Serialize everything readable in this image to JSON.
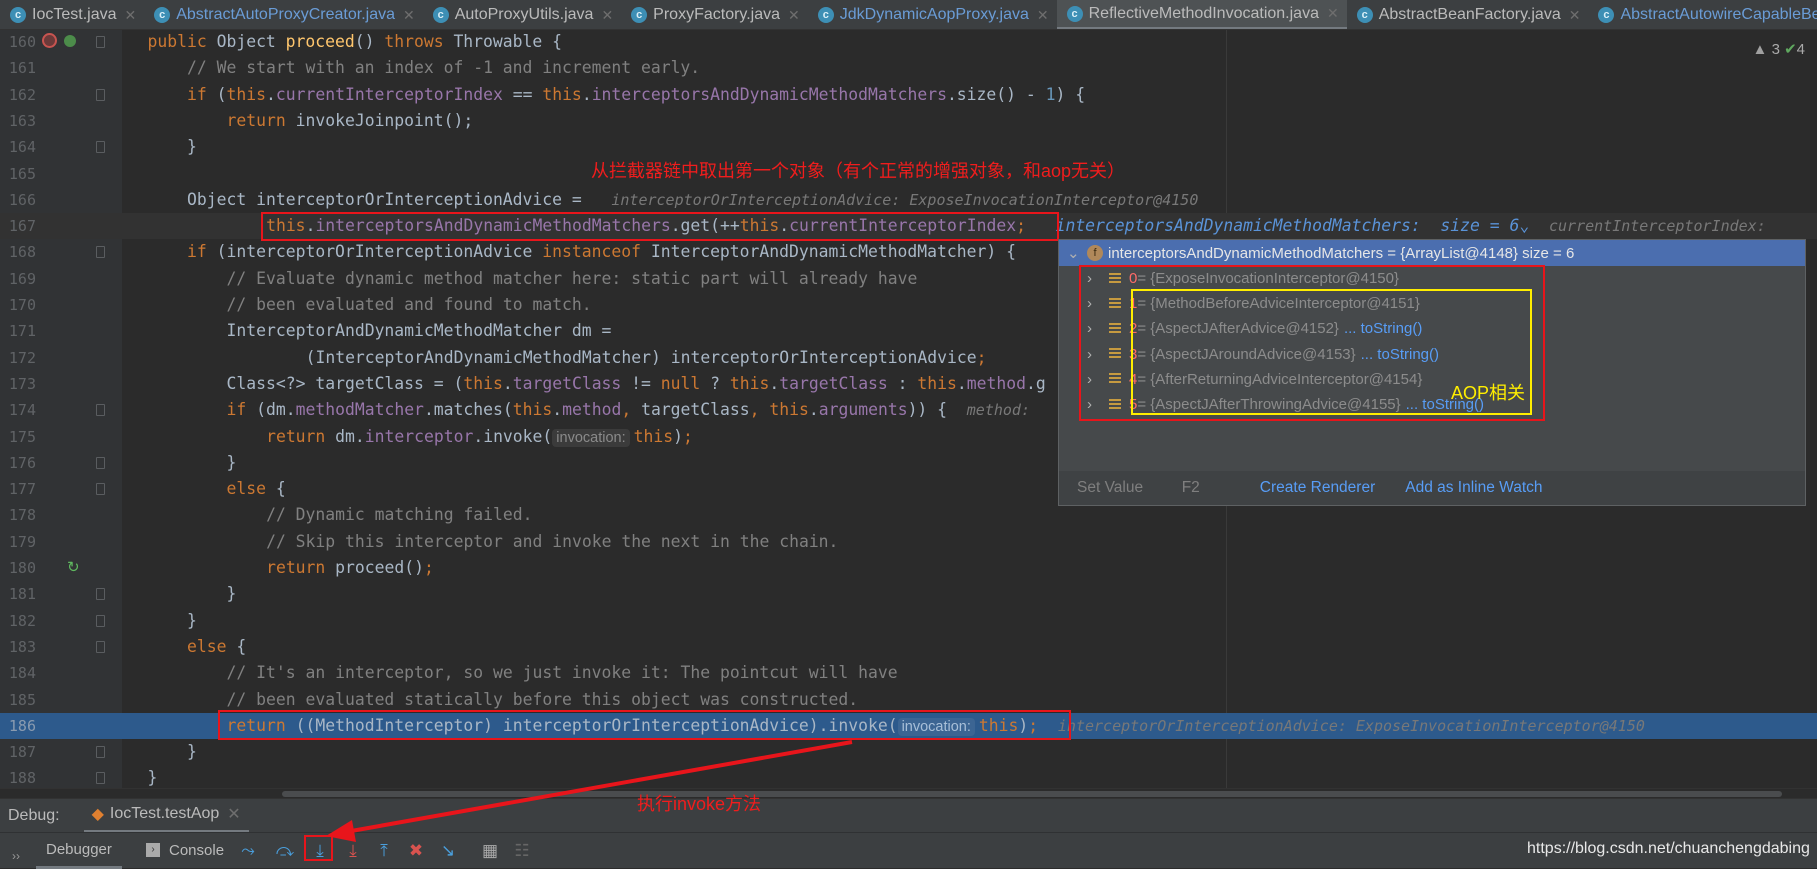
{
  "tabs": [
    {
      "label": "IocTest.java",
      "style": "normal"
    },
    {
      "label": "AbstractAutoProxyCreator.java",
      "style": "blue"
    },
    {
      "label": "AutoProxyUtils.java",
      "style": "normal"
    },
    {
      "label": "ProxyFactory.java",
      "style": "normal"
    },
    {
      "label": "JdkDynamicAopProxy.java",
      "style": "blue"
    },
    {
      "label": "ReflectiveMethodInvocation.java",
      "style": "active"
    },
    {
      "label": "AbstractBeanFactory.java",
      "style": "normal"
    },
    {
      "label": "AbstractAutowireCapableBeanFactory.java",
      "style": "blue"
    }
  ],
  "inspections": {
    "warnings": "3",
    "ok": "4"
  },
  "current_line": 167,
  "execution_line": 186,
  "code": [
    {
      "n": "160",
      "i": 1,
      "t": [
        [
          "kw",
          "public "
        ],
        [
          "",
          "Object "
        ],
        [
          "fn",
          "proceed"
        ],
        [
          "",
          "() "
        ],
        [
          "kw",
          "throws "
        ],
        [
          "",
          "Throwable {"
        ]
      ]
    },
    {
      "n": "161",
      "i": 2,
      "t": [
        [
          "cm",
          "// We start with an index of -1 and increment early."
        ]
      ]
    },
    {
      "n": "162",
      "i": 2,
      "t": [
        [
          "kw",
          "if "
        ],
        [
          "",
          "("
        ],
        [
          "kw",
          "this"
        ],
        [
          "",
          "."
        ],
        [
          "fld",
          "currentInterceptorIndex"
        ],
        [
          "",
          " == "
        ],
        [
          "kw",
          "this"
        ],
        [
          "",
          "."
        ],
        [
          "fld",
          "interceptorsAndDynamicMethodMatchers"
        ],
        [
          "",
          ".size() - "
        ],
        [
          "num",
          "1"
        ],
        [
          "",
          ") {"
        ]
      ]
    },
    {
      "n": "163",
      "i": 3,
      "t": [
        [
          "kw",
          "return "
        ],
        [
          "",
          "invokeJoinpoint();"
        ]
      ]
    },
    {
      "n": "164",
      "i": 2,
      "t": [
        [
          "",
          "}"
        ]
      ]
    },
    {
      "n": "165",
      "i": 0,
      "t": []
    },
    {
      "n": "166",
      "i": 2,
      "t": [
        [
          "",
          "Object interceptorOrInterceptionAdvice =   "
        ],
        [
          "hint",
          "interceptorOrInterceptionAdvice: ExposeInvocationInterceptor@4150"
        ]
      ]
    },
    {
      "n": "167",
      "i": 4,
      "t": [
        [
          "kw",
          "this"
        ],
        [
          "",
          "."
        ],
        [
          "fld",
          "interceptorsAndDynamicMethodMatchers"
        ],
        [
          "",
          ".get(++"
        ],
        [
          "kw",
          "this"
        ],
        [
          "",
          "."
        ],
        [
          "fld",
          "currentInterceptorIndex"
        ],
        [
          "kw",
          ";"
        ],
        [
          "",
          " "
        ],
        [
          "hintb",
          "  interceptorsAndDynamicMethodMatchers:  size = 6⌄  "
        ],
        [
          "hint",
          "currentInterceptorIndex:"
        ]
      ]
    },
    {
      "n": "168",
      "i": 2,
      "t": [
        [
          "kw",
          "if "
        ],
        [
          "",
          "(interceptorOrInterceptionAdvice "
        ],
        [
          "kw",
          "instanceof "
        ],
        [
          "",
          "InterceptorAndDynamicMethodMatcher) {"
        ]
      ]
    },
    {
      "n": "169",
      "i": 3,
      "t": [
        [
          "cm",
          "// Evaluate dynamic method matcher here: static part will already have"
        ]
      ]
    },
    {
      "n": "170",
      "i": 3,
      "t": [
        [
          "cm",
          "// been evaluated and found to match."
        ]
      ]
    },
    {
      "n": "171",
      "i": 3,
      "t": [
        [
          "",
          "InterceptorAndDynamicMethodMatcher dm ="
        ]
      ]
    },
    {
      "n": "172",
      "i": 5,
      "t": [
        [
          "",
          "(InterceptorAndDynamicMethodMatcher) interceptorOrInterceptionAdvice"
        ],
        [
          "kw",
          ";"
        ]
      ]
    },
    {
      "n": "173",
      "i": 3,
      "t": [
        [
          "",
          "Class<?> targetClass = ("
        ],
        [
          "kw",
          "this"
        ],
        [
          "",
          "."
        ],
        [
          "fld",
          "targetClass"
        ],
        [
          "",
          " != "
        ],
        [
          "kw",
          "null "
        ],
        [
          "",
          "? "
        ],
        [
          "kw",
          "this"
        ],
        [
          "",
          "."
        ],
        [
          "fld",
          "targetClass"
        ],
        [
          "",
          " : "
        ],
        [
          "kw",
          "this"
        ],
        [
          "",
          "."
        ],
        [
          "fld",
          "method"
        ],
        [
          "",
          ".g"
        ]
      ]
    },
    {
      "n": "174",
      "i": 3,
      "t": [
        [
          "kw",
          "if "
        ],
        [
          "",
          "(dm."
        ],
        [
          "fld",
          "methodMatcher"
        ],
        [
          "",
          ".matches("
        ],
        [
          "kw",
          "this"
        ],
        [
          "",
          "."
        ],
        [
          "fld",
          "method"
        ],
        [
          "kw",
          ", "
        ],
        [
          "",
          "targetClass"
        ],
        [
          "kw",
          ", "
        ],
        [
          "kw",
          "this"
        ],
        [
          "",
          "."
        ],
        [
          "fld",
          "arguments"
        ],
        [
          "",
          ")) {  "
        ],
        [
          "hint",
          "method:"
        ]
      ]
    },
    {
      "n": "175",
      "i": 4,
      "t": [
        [
          "kw",
          "return "
        ],
        [
          "",
          "dm."
        ],
        [
          "fld",
          "interceptor"
        ],
        [
          "",
          ".invoke("
        ],
        [
          "phint",
          "invocation:"
        ],
        [
          "kw",
          "this"
        ],
        [
          "",
          ")"
        ],
        [
          "kw",
          ";"
        ]
      ]
    },
    {
      "n": "176",
      "i": 3,
      "t": [
        [
          "",
          "}"
        ]
      ]
    },
    {
      "n": "177",
      "i": 3,
      "t": [
        [
          "kw",
          "else "
        ],
        [
          "",
          "{"
        ]
      ]
    },
    {
      "n": "178",
      "i": 4,
      "t": [
        [
          "cm",
          "// Dynamic matching failed."
        ]
      ]
    },
    {
      "n": "179",
      "i": 4,
      "t": [
        [
          "cm",
          "// Skip this interceptor and invoke the next in the chain."
        ]
      ]
    },
    {
      "n": "180",
      "i": 4,
      "t": [
        [
          "kw",
          "return "
        ],
        [
          "",
          "proceed()"
        ],
        [
          "kw",
          ";"
        ]
      ]
    },
    {
      "n": "181",
      "i": 3,
      "t": [
        [
          "",
          "}"
        ]
      ]
    },
    {
      "n": "182",
      "i": 2,
      "t": [
        [
          "",
          "}"
        ]
      ]
    },
    {
      "n": "183",
      "i": 2,
      "t": [
        [
          "kw",
          "else "
        ],
        [
          "",
          "{"
        ]
      ]
    },
    {
      "n": "184",
      "i": 3,
      "t": [
        [
          "cm",
          "// It's an interceptor, so we just invoke it: The pointcut will have"
        ]
      ]
    },
    {
      "n": "185",
      "i": 3,
      "t": [
        [
          "cm",
          "// been evaluated statically before this object was constructed."
        ]
      ]
    },
    {
      "n": "186",
      "i": 3,
      "t": [
        [
          "kw",
          "return "
        ],
        [
          "",
          "((MethodInterceptor) interceptorOrInterceptionAdvice).invoke("
        ],
        [
          "phint",
          "invocation:"
        ],
        [
          "kw",
          "this"
        ],
        [
          "",
          ")"
        ],
        [
          "kw",
          ";"
        ],
        [
          "",
          "  "
        ],
        [
          "hint",
          "interceptorOrInterceptionAdvice: ExposeInvocationInterceptor@4150"
        ]
      ]
    },
    {
      "n": "187",
      "i": 2,
      "t": [
        [
          "",
          "}"
        ]
      ]
    },
    {
      "n": "188",
      "i": 1,
      "t": [
        [
          "",
          "}"
        ]
      ]
    }
  ],
  "popup": {
    "header": "interceptorsAndDynamicMethodMatchers = {ArrayList@4148}  size = 6",
    "field_icon": "f",
    "items": [
      {
        "idx": "0",
        "val": " = {ExposeInvocationInterceptor@4150}",
        "ts": ""
      },
      {
        "idx": "1",
        "val": " = {MethodBeforeAdviceInterceptor@4151}",
        "ts": ""
      },
      {
        "idx": "2",
        "val": " = {AspectJAfterAdvice@4152}",
        "ts": "... toString()"
      },
      {
        "idx": "3",
        "val": " = {AspectJAroundAdvice@4153}",
        "ts": "... toString()"
      },
      {
        "idx": "4",
        "val": " = {AfterReturningAdviceInterceptor@4154}",
        "ts": ""
      },
      {
        "idx": "5",
        "val": " = {AspectJAfterThrowingAdvice@4155}",
        "ts": "... toString()"
      }
    ],
    "footer": {
      "set_value": "Set Value",
      "set_value_key": "F2",
      "create_renderer": "Create Renderer",
      "inline_watch": "Add as Inline Watch"
    }
  },
  "annotations": {
    "first_object": "从拦截器链中取出第一个对象（有个正常的增强对象，和aop无关）",
    "aop_related": "AOP相关",
    "invoke": "执行invoke方法",
    "color_red": "#e8151b",
    "color_yellow": "#ffee00"
  },
  "debug": {
    "label": "Debug:",
    "session": "IocTest.testAop",
    "tabs": [
      "Debugger",
      "Console"
    ],
    "toolbar_icons": [
      "show-execution-point",
      "step-over",
      "step-into",
      "force-step-into",
      "step-out",
      "drop-frame",
      "run-to-cursor",
      "evaluate-expression",
      "trace"
    ]
  },
  "watermark": "https://blog.csdn.net/chuanchengdabing"
}
